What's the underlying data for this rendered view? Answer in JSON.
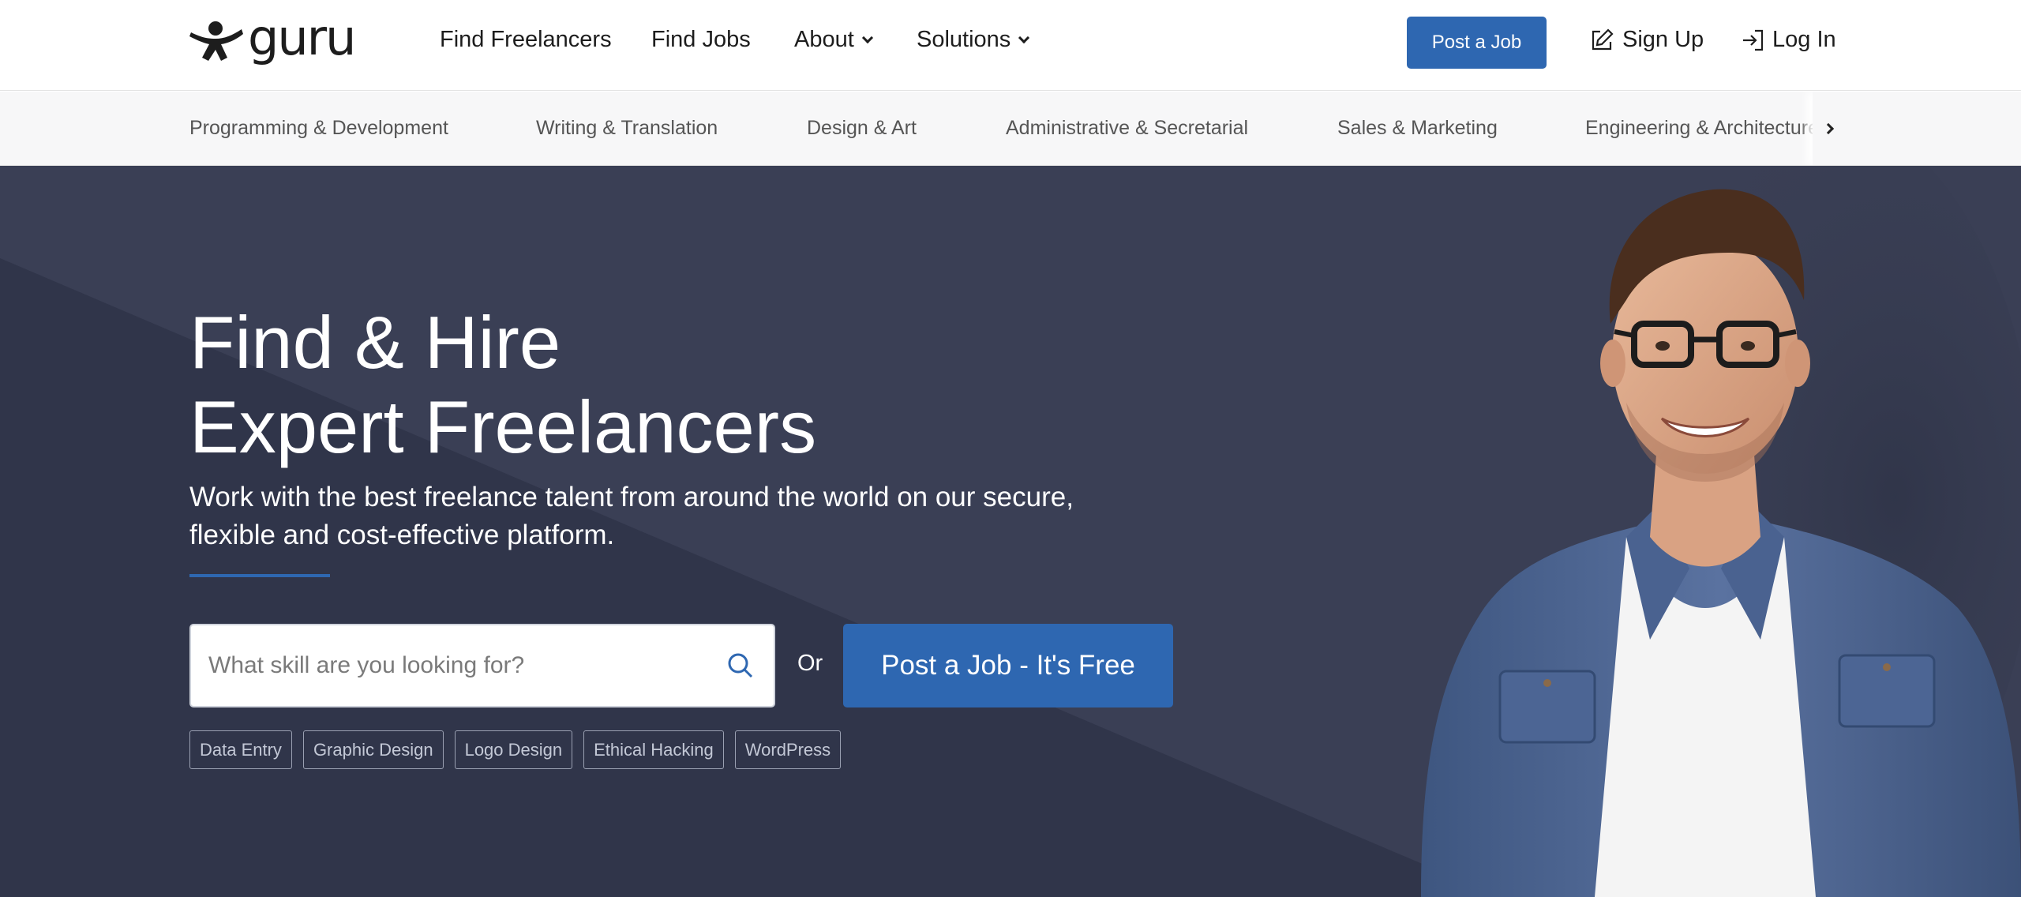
{
  "brand": {
    "logo_text": "guru",
    "logo_icon": "guru-figure-icon"
  },
  "nav": {
    "find_freelancers": "Find Freelancers",
    "find_jobs": "Find Jobs",
    "about": "About",
    "solutions": "Solutions",
    "post_job": "Post a Job",
    "sign_up": "Sign Up",
    "log_in": "Log In"
  },
  "categories": [
    "Programming & Development",
    "Writing & Translation",
    "Design & Art",
    "Administrative & Secretarial",
    "Sales & Marketing",
    "Engineering & Architecture"
  ],
  "hero": {
    "headline_line1": "Find & Hire",
    "headline_line2": "Expert Freelancers",
    "subline": "Work with the best freelance talent from around the world on our secure, flexible and cost-effective platform.",
    "search_placeholder": "What skill are you looking for?",
    "or_text": "Or",
    "post_button": "Post a Job - It's Free",
    "tags": [
      "Data Entry",
      "Graphic Design",
      "Logo Design",
      "Ethical Hacking",
      "WordPress"
    ]
  },
  "colors": {
    "accent": "#2e67b1",
    "hero_bg": "#3a3f55",
    "hero_bg_dark": "#30354a",
    "category_bg": "#f7f7f8"
  }
}
